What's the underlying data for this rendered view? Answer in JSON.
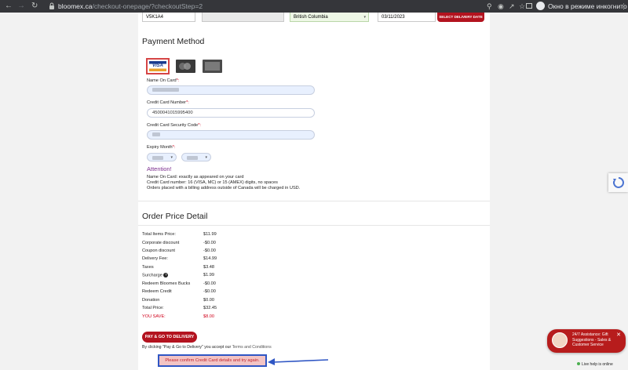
{
  "browser": {
    "url_host": "bloomex.ca",
    "url_path": "/checkout-onepage/?checkoutStep=2",
    "incognito_label": "Окно в режиме инкогнито"
  },
  "top_form": {
    "postal_code": "V5K1A4",
    "province": "British Columbia",
    "date": "03/11/2023",
    "select_delivery_date": "SELECT DELIVERY DATE"
  },
  "payment": {
    "heading": "Payment Method",
    "cards": [
      {
        "name": "visa-card-icon",
        "text": "VISA"
      },
      {
        "name": "mastercard-card-icon",
        "text": "MasterCard"
      },
      {
        "name": "amex-card-icon",
        "text": "AMERICAN EXPRESS"
      }
    ],
    "name_label": "Name On Card",
    "number_label": "Credit Card Number",
    "number_value": "4500041015995400",
    "cvv_label": "Credit Card Security Code",
    "expiry_label": "Expiry Month",
    "required_mark": "*:",
    "attention": "Attention!",
    "notes": [
      "Name On Card: exactly as appeared on your card",
      "Credit Card number: 16 (VISA, MC) or 15 (AMEX) digits, no spaces",
      "Orders placed with a billing address outside of Canada will be charged in USD."
    ]
  },
  "order": {
    "heading": "Order Price Detail",
    "rows": [
      {
        "label": "Total Items Price:",
        "value": "$11.99"
      },
      {
        "label": "Corporate discount",
        "value": "-$0.00"
      },
      {
        "label": "Coupon discount",
        "value": "-$0.00"
      },
      {
        "label": "Delivery Fee:",
        "value": "$14.99"
      },
      {
        "label": "Taxes",
        "value": "$3.48"
      },
      {
        "label": "Surcharge",
        "value": "$1.99"
      },
      {
        "label": "Redeem Bloomex Bucks",
        "value": "-$0.00"
      },
      {
        "label": "Redeem Credit",
        "value": "-$0.00"
      },
      {
        "label": "Donation",
        "value": "$0.00"
      },
      {
        "label": "Total Price:",
        "value": "$32.45"
      },
      {
        "label": "YOU SAVE:",
        "value": "$8.00"
      }
    ],
    "save_color": "#d0021b",
    "pay_button": "PAY & GO TO DELIVERY",
    "terms_prefix": "By clicking \"Pay & Go to Delivery\" you accept our ",
    "terms_link": "Terms and Conditions",
    "error": "Please confirm Credit Card details and try again."
  },
  "chat": {
    "text": "24/7 Assistance: Gift Suggestions - Sales & Customer Service",
    "live_help": "Live help is online"
  },
  "colors": {
    "brand_red": "#b3131f",
    "attention_purple": "#7b2d8e",
    "annotation_blue": "#2f56c4",
    "error_bg": "#f3c4c4"
  }
}
